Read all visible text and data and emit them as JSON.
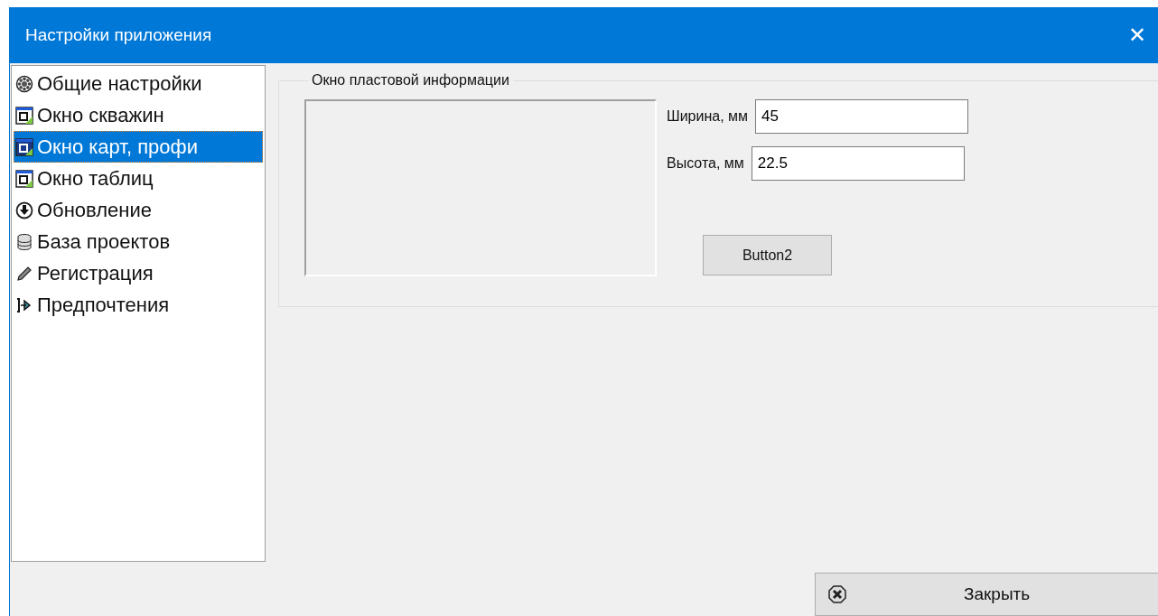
{
  "window": {
    "title": "Настройки приложения",
    "close": "✕"
  },
  "sidebar": {
    "items": [
      {
        "label": "Общие настройки",
        "selected": false
      },
      {
        "label": "Окно скважин",
        "selected": false
      },
      {
        "label": "Окно карт, профи",
        "selected": true
      },
      {
        "label": "Окно таблиц",
        "selected": false
      },
      {
        "label": "Обновление",
        "selected": false
      },
      {
        "label": "База проектов",
        "selected": false
      },
      {
        "label": "Регистрация",
        "selected": false
      },
      {
        "label": "Предпочтения",
        "selected": false
      }
    ]
  },
  "group": {
    "title": "Окно пластовой информации",
    "fields": [
      {
        "label": "Ширина, мм",
        "value": "45"
      },
      {
        "label": "Высота, мм",
        "value": "22.5"
      }
    ],
    "button": "Button2"
  },
  "footer": {
    "button": "Закрыть"
  }
}
